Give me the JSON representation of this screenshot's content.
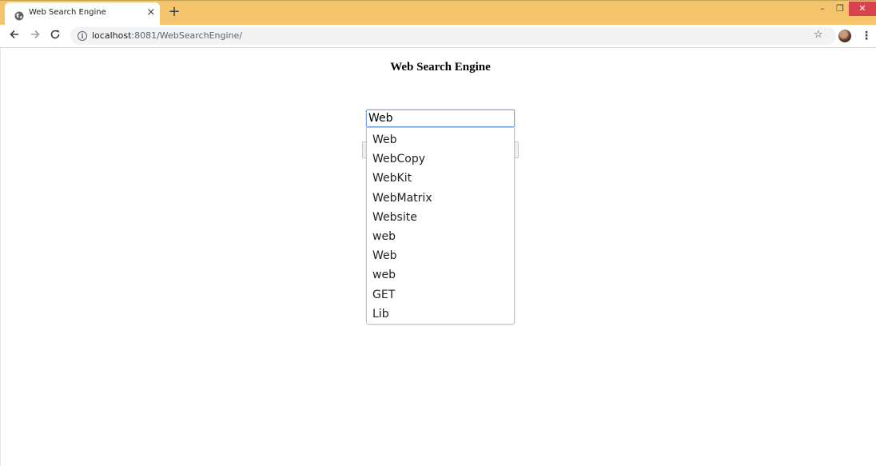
{
  "browser": {
    "tab_title": "Web Search Engine",
    "tab_close": "×",
    "new_tab": "+",
    "url_host": "localhost",
    "url_rest": ":8081/WebSearchEngine/",
    "window_controls": {
      "minimize": "–",
      "restore": "❐",
      "close": "✕"
    },
    "accent_color": "#f4c56c"
  },
  "page": {
    "title": "Web Search Engine",
    "search": {
      "value": "Web",
      "suggestions": [
        "Web",
        "WebCopy",
        "WebKit",
        "WebMatrix",
        "Website",
        "web",
        "Web",
        "web",
        "GET",
        "Lib"
      ]
    }
  },
  "icons": {
    "back": "arrow-left-icon",
    "forward": "arrow-right-icon",
    "reload": "reload-icon",
    "info": "info-icon",
    "star": "star-icon",
    "menu": "kebab-menu-icon",
    "favicon": "globe-icon"
  }
}
